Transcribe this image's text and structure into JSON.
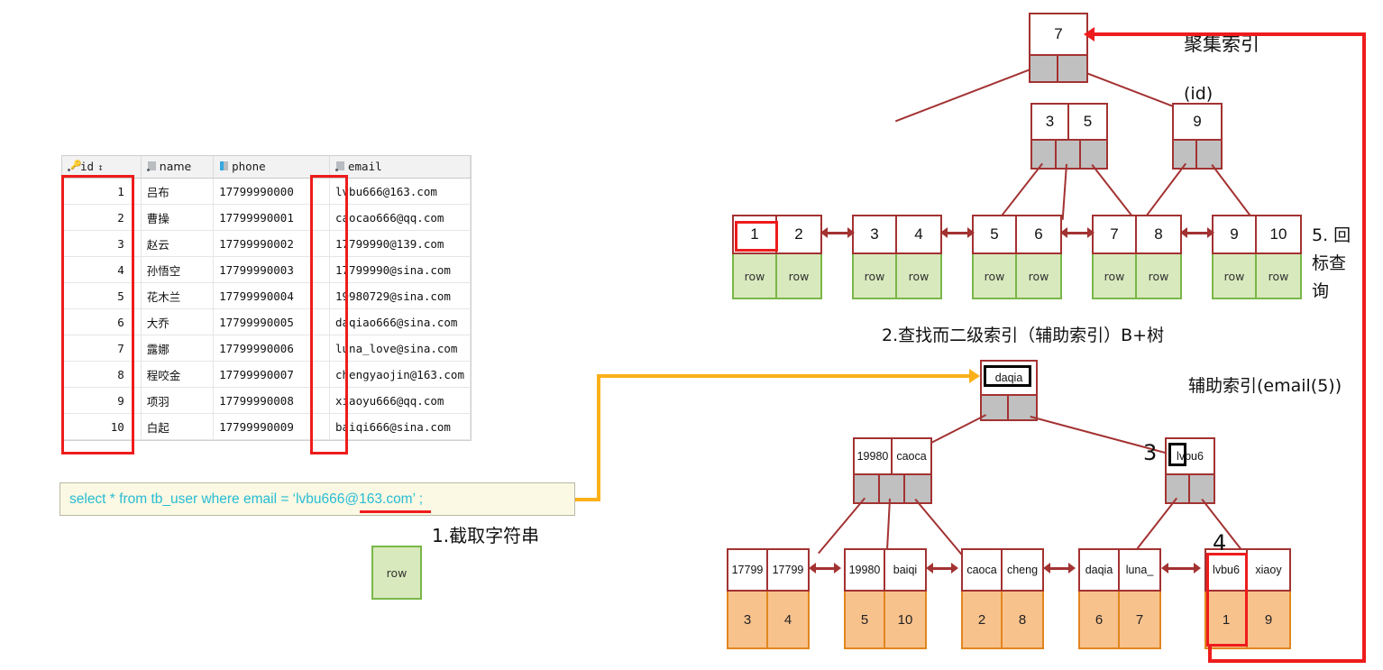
{
  "table": {
    "columns": [
      {
        "key": "id",
        "label": "id",
        "icon": "primary-key-icon",
        "sortable": true,
        "sort_marker": "↕"
      },
      {
        "key": "name",
        "label": "name",
        "icon": "column-icon"
      },
      {
        "key": "phone",
        "label": "phone",
        "icon": "column-icon"
      },
      {
        "key": "email",
        "label": "email",
        "icon": "column-icon"
      }
    ],
    "rows": [
      {
        "id": "1",
        "name": "吕布",
        "phone": "17799990000",
        "email": "lvbu666@163.com"
      },
      {
        "id": "2",
        "name": "曹操",
        "phone": "17799990001",
        "email": "caocao666@qq.com"
      },
      {
        "id": "3",
        "name": "赵云",
        "phone": "17799990002",
        "email": "17799990@139.com"
      },
      {
        "id": "4",
        "name": "孙悟空",
        "phone": "17799990003",
        "email": "17799990@sina.com"
      },
      {
        "id": "5",
        "name": "花木兰",
        "phone": "17799990004",
        "email": "19980729@sina.com"
      },
      {
        "id": "6",
        "name": "大乔",
        "phone": "17799990005",
        "email": "daqiao666@sina.com"
      },
      {
        "id": "7",
        "name": "露娜",
        "phone": "17799990006",
        "email": "luna_love@sina.com"
      },
      {
        "id": "8",
        "name": "程咬金",
        "phone": "17799990007",
        "email": "chengyaojin@163.com"
      },
      {
        "id": "9",
        "name": "项羽",
        "phone": "17799990008",
        "email": "xiaoyu666@qq.com"
      },
      {
        "id": "10",
        "name": "白起",
        "phone": "17799990009",
        "email": "baiqi666@sina.com"
      }
    ],
    "highlight_columns": [
      "id",
      "email"
    ],
    "highlight_color": "#ee1c1c"
  },
  "sql": {
    "text": "select * from tb_user where email = ‘lvbu666@163.com’ ;",
    "text_color": "#27bcd4",
    "background": "#fbf8e3",
    "underlined_token": "lvbu6",
    "underline_color": "#ee1c1c"
  },
  "annotations": {
    "step1": "1.截取字符串",
    "step2": "2.查找而二级索引（辅助索引）B+树",
    "step3": "3",
    "step4": "4",
    "step5_lines": [
      "5. 回",
      "标查",
      "询"
    ],
    "clustered_label": "聚集索引",
    "clustered_sub": "(id)",
    "secondary_label": "辅助索引(email(5))",
    "row_label": "row"
  },
  "clustered_index": {
    "title": "聚集索引 (id)",
    "root": {
      "keys": [
        "7"
      ],
      "pointers": 2
    },
    "internal": [
      {
        "keys": [
          "3",
          "5"
        ],
        "pointers": 3
      },
      {
        "keys": [
          "9"
        ],
        "pointers": 2
      }
    ],
    "leaves": [
      {
        "keys": [
          "1",
          "2"
        ],
        "rows": [
          "row",
          "row"
        ],
        "highlight_index": 0
      },
      {
        "keys": [
          "3",
          "4"
        ],
        "rows": [
          "row",
          "row"
        ]
      },
      {
        "keys": [
          "5",
          "6"
        ],
        "rows": [
          "row",
          "row"
        ]
      },
      {
        "keys": [
          "7",
          "8"
        ],
        "rows": [
          "row",
          "row"
        ]
      },
      {
        "keys": [
          "9",
          "10"
        ],
        "rows": [
          "row",
          "row"
        ]
      }
    ]
  },
  "secondary_index": {
    "title": "辅助索引(email(5))",
    "root": {
      "keys": [
        "daqia"
      ],
      "pointers": 2,
      "boxed_key": "daqia"
    },
    "internal": [
      {
        "keys": [
          "19980",
          "caoca"
        ],
        "pointers": 3
      },
      {
        "keys": [
          "lvbu6"
        ],
        "pointers": 2,
        "boxed_key": "lvbu6"
      }
    ],
    "leaves": [
      {
        "keys": [
          "17799",
          "17799"
        ],
        "ids": [
          "3",
          "4"
        ]
      },
      {
        "keys": [
          "19980",
          "baiqi"
        ],
        "ids": [
          "5",
          "10"
        ]
      },
      {
        "keys": [
          "caoca",
          "cheng"
        ],
        "ids": [
          "2",
          "8"
        ]
      },
      {
        "keys": [
          "daqia",
          "luna_"
        ],
        "ids": [
          "6",
          "7"
        ]
      },
      {
        "keys": [
          "lvbu6",
          "xiaoy"
        ],
        "ids": [
          "1",
          "9"
        ],
        "highlight_index": 0
      }
    ]
  },
  "colors": {
    "node_border": "#a33232",
    "pointer_fill": "#c0c0c0",
    "row_fill": "#d8e9bd",
    "row_border": "#7ab648",
    "id_fill": "#f8c28d",
    "id_border": "#e1861f",
    "highlight_red": "#ee1c1c",
    "arrow_orange": "#fbb019"
  }
}
